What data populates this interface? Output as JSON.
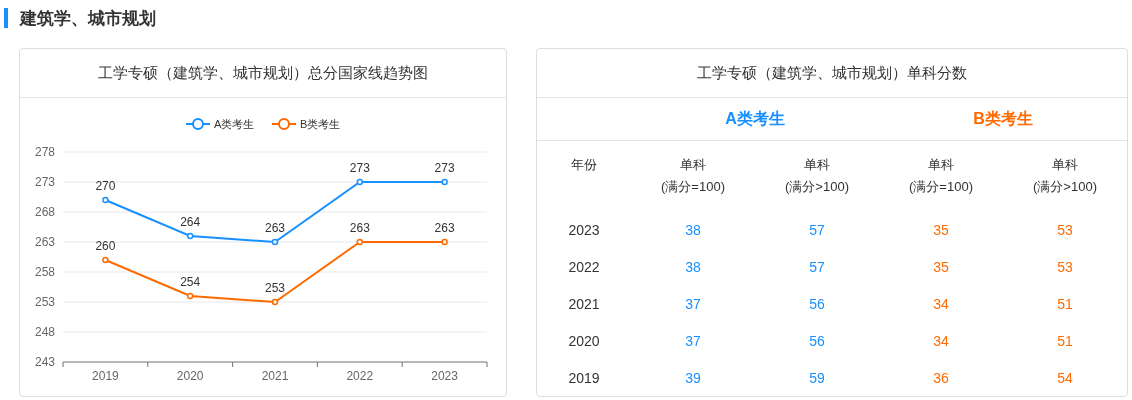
{
  "section": {
    "title": "建筑学、城市规划"
  },
  "trend_card": {
    "title": "工学专硕（建筑学、城市规划）总分国家线趋势图",
    "chart_data": {
      "type": "line",
      "categories": [
        "2019",
        "2020",
        "2021",
        "2022",
        "2023"
      ],
      "ylim": [
        243,
        278
      ],
      "yticks": [
        243,
        248,
        253,
        258,
        263,
        268,
        273,
        278
      ],
      "data_labels": true,
      "grid": true,
      "legend": true,
      "series": [
        {
          "name": "A类考生",
          "color": "#1890ff",
          "marker": "circle",
          "values": [
            270,
            264,
            263,
            273,
            273
          ]
        },
        {
          "name": "B类考生",
          "color": "#ff6a00",
          "marker": "circle",
          "values": [
            260,
            254,
            253,
            263,
            263
          ]
        }
      ]
    }
  },
  "subject_card": {
    "title": "工学专硕（建筑学、城市规划）单科分数",
    "year_header": "年份",
    "groups": [
      {
        "label": "A类考生",
        "color": "#1890ff",
        "columns": [
          {
            "label": "单科",
            "note": "(满分=100)"
          },
          {
            "label": "单科",
            "note": "(满分>100)"
          }
        ]
      },
      {
        "label": "B类考生",
        "color": "#ff6a00",
        "columns": [
          {
            "label": "单科",
            "note": "(满分=100)"
          },
          {
            "label": "单科",
            "note": "(满分>100)"
          }
        ]
      }
    ],
    "rows": [
      [
        "2023",
        "38",
        "57",
        "35",
        "53"
      ],
      [
        "2022",
        "38",
        "57",
        "35",
        "53"
      ],
      [
        "2021",
        "37",
        "56",
        "34",
        "51"
      ],
      [
        "2020",
        "37",
        "56",
        "34",
        "51"
      ],
      [
        "2019",
        "39",
        "59",
        "36",
        "54"
      ]
    ]
  }
}
